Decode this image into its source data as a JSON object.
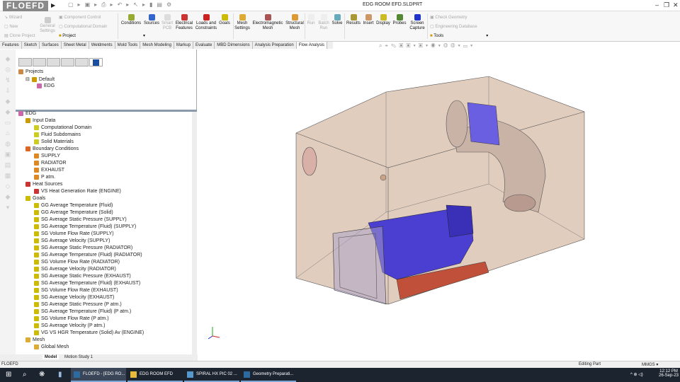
{
  "app": {
    "logo": "FLOEFD",
    "title": "EDG ROOM EFD.SLDPRT"
  },
  "ribbon": {
    "left_small": [
      "Wizard",
      "New",
      "Clone Project"
    ],
    "general_settings": "General Settings",
    "mid_small": [
      "Component Control",
      "Computational Domain"
    ],
    "project": "Project",
    "buttons": [
      "Conditions",
      "Sources",
      "Smart PCB",
      "Electrical Features",
      "Loads and Constraints",
      "Goals",
      "Mesh Settings",
      "Electromagnetic Mesh",
      "Structural Mesh",
      "Run",
      "Batch Run",
      "Solve",
      "Results",
      "Insert",
      "Display",
      "Probes",
      "Screen Capture"
    ],
    "right_small": [
      "Check Geometry",
      "Engineering Database"
    ],
    "tools": "Tools"
  },
  "tabs": [
    "Features",
    "Sketch",
    "Surfaces",
    "Sheet Metal",
    "Weldments",
    "Mold Tools",
    "Mesh Modeling",
    "Markup",
    "Evaluate",
    "MBD Dimensions",
    "Analysis Preparation",
    "Flow Analysis"
  ],
  "projects_tree": {
    "root": "Projects",
    "config": "Default",
    "item": "EDG"
  },
  "analysis_tree": {
    "root": "EDG",
    "input_data": "Input Data",
    "input_children": [
      "Computational Domain",
      "Fluid Subdomains",
      "Solid Materials"
    ],
    "boundary_conditions": "Boundary Conditions",
    "bc_children": [
      "SUPPLY",
      "RADIATOR",
      "EXHAUST",
      "P atm."
    ],
    "heat_sources": "Heat Sources",
    "hs_children": [
      "VS Heat Generation Rate (ENGINE)"
    ],
    "goals": "Goals",
    "goal_children": [
      "GG Average Temperature (Fluid)",
      "GG Average Temperature (Solid)",
      "SG Average Static Pressure (SUPPLY)",
      "SG Average Temperature (Fluid) (SUPPLY)",
      "SG Volume Flow Rate (SUPPLY)",
      "SG Average Velocity (SUPPLY)",
      "SG Average Static Pressure (RADIATOR)",
      "SG Average Temperature (Fluid) (RADIATOR)",
      "SG Volume Flow Rate (RADIATOR)",
      "SG Average Velocity (RADIATOR)",
      "SG Average Static Pressure (EXHAUST)",
      "SG Average Temperature (Fluid) (EXHAUST)",
      "SG Volume Flow Rate (EXHAUST)",
      "SG Average Velocity (EXHAUST)",
      "SG Average Static Pressure (P atm.)",
      "SG Average Temperature (Fluid) (P atm.)",
      "SG Volume Flow Rate (P atm.)",
      "SG Average Velocity (P atm.)",
      "VG VS HGR Temperature (Solid) Av (ENGINE)"
    ],
    "mesh": "Mesh",
    "mesh_children": [
      "Global Mesh"
    ]
  },
  "bottom_tabs": [
    "Model",
    "Motion Study 1"
  ],
  "status": {
    "left": "FLOEFD",
    "mode": "Editing Part",
    "units": "MMGS"
  },
  "taskbar": {
    "tasks": [
      "FLOEFD - [EDG RO...",
      "EDG ROOM EFD",
      "SPIRAL HX PIC 02 ...",
      "Geometry Preparati..."
    ],
    "time": "12:12 PM",
    "date": "26-Sep-23"
  },
  "colors": {
    "box": "#c8a488",
    "engine": "#4a3fd0",
    "base": "#c0503a",
    "duct": "#c9b2a6",
    "duct_band": "#6a5fe0"
  }
}
